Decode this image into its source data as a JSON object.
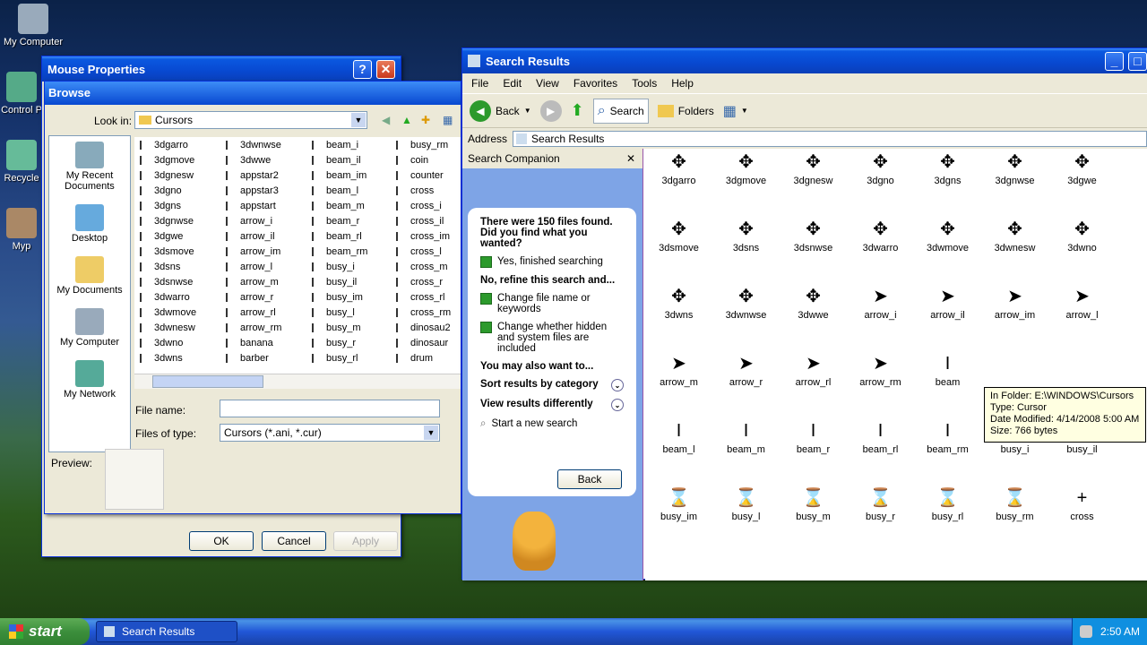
{
  "desktop": {
    "icons": [
      "My Computer",
      "Control P",
      "Recycle",
      "Myp"
    ]
  },
  "mouse_props": {
    "title": "Mouse Properties",
    "ok": "OK",
    "cancel": "Cancel",
    "apply": "Apply"
  },
  "browse": {
    "title": "Browse",
    "look_in_label": "Look in:",
    "look_in_value": "Cursors",
    "places": [
      "My Recent Documents",
      "Desktop",
      "My Documents",
      "My Computer",
      "My Network"
    ],
    "files": [
      [
        "3dgarro",
        "3dgmove",
        "3dgnesw",
        "3dgno",
        "3dgns",
        "3dgnwse",
        "3dgwe",
        "3dsmove",
        "3dsns",
        "3dsnwse",
        "3dwarro",
        "3dwmove",
        "3dwnesw",
        "3dwno",
        "3dwns"
      ],
      [
        "3dwnwse",
        "3dwwe",
        "appstar2",
        "appstar3",
        "appstart",
        "arrow_i",
        "arrow_il",
        "arrow_im",
        "arrow_l",
        "arrow_m",
        "arrow_r",
        "arrow_rl",
        "arrow_rm",
        "banana",
        "barber"
      ],
      [
        "beam_i",
        "beam_il",
        "beam_im",
        "beam_l",
        "beam_m",
        "beam_r",
        "beam_rl",
        "beam_rm",
        "busy_i",
        "busy_il",
        "busy_im",
        "busy_l",
        "busy_m",
        "busy_r",
        "busy_rl"
      ],
      [
        "busy_rm",
        "coin",
        "counter",
        "cross",
        "cross_i",
        "cross_il",
        "cross_im",
        "cross_l",
        "cross_m",
        "cross_r",
        "cross_rl",
        "cross_rm",
        "dinosau2",
        "dinosaur",
        "drum"
      ]
    ],
    "filename_label": "File name:",
    "filetype_label": "Files of type:",
    "filetype_value": "Cursors (*.ani, *.cur)",
    "preview_label": "Preview:"
  },
  "search": {
    "title": "Search Results",
    "menu": [
      "File",
      "Edit",
      "View",
      "Favorites",
      "Tools",
      "Help"
    ],
    "toolbar": {
      "back": "Back",
      "search": "Search",
      "folders": "Folders"
    },
    "address_label": "Address",
    "address_value": "Search Results",
    "companion": {
      "title": "Search Companion",
      "found": "There were 150 files found. Did you find what you wanted?",
      "yes": "Yes, finished searching",
      "refine": "No, refine this search and...",
      "change_name": "Change file name or keywords",
      "change_hidden": "Change whether hidden and system files are included",
      "also": "You may also want to...",
      "sort": "Sort results by category",
      "view": "View results differently",
      "new_search": "Start a new search",
      "back_btn": "Back"
    },
    "icons": [
      "3dgarro",
      "3dgmove",
      "3dgnesw",
      "3dgno",
      "3dgns",
      "3dgnwse",
      "3dgwe",
      "3dsmove",
      "3dsns",
      "3dsnwse",
      "3dwarro",
      "3dwmove",
      "3dwnesw",
      "3dwno",
      "3dwns",
      "3dwnwse",
      "3dwwe",
      "arrow_i",
      "arrow_il",
      "arrow_im",
      "arrow_l",
      "arrow_m",
      "arrow_r",
      "arrow_rl",
      "arrow_rm",
      "beam",
      "",
      "",
      "beam_l",
      "beam_m",
      "beam_r",
      "beam_rl",
      "beam_rm",
      "busy_i",
      "busy_il",
      "busy_im",
      "busy_l",
      "busy_m",
      "busy_r",
      "busy_rl",
      "busy_rm",
      "cross"
    ],
    "tooltip": [
      "In Folder: E:\\WINDOWS\\Cursors",
      "Type: Cursor",
      "Date Modified: 4/14/2008 5:00 AM",
      "Size: 766 bytes"
    ]
  },
  "taskbar": {
    "start": "start",
    "task": "Search Results",
    "time": "2:50 AM"
  }
}
